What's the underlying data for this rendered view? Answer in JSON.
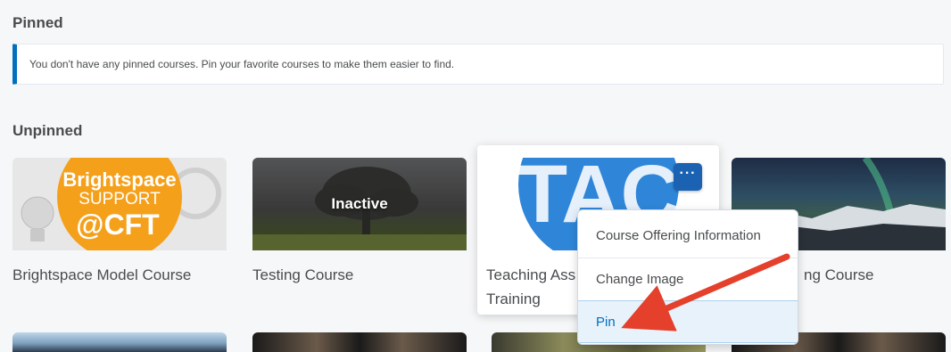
{
  "pinned": {
    "title": "Pinned",
    "empty_message": "You don't have any pinned courses. Pin your favorite courses to make them easier to find."
  },
  "unpinned": {
    "title": "Unpinned",
    "courses": [
      {
        "name": "Brightspace Model Course",
        "image_text": [
          "Brightspace",
          "SUPPORT",
          "@CFT"
        ]
      },
      {
        "name": "Testing Course",
        "overlay": "Inactive"
      },
      {
        "name": "Teaching Ass",
        "name_line2": "Training",
        "image_text": "TAC"
      },
      {
        "name": "ng Course"
      }
    ]
  },
  "course_menu": {
    "more_label": "···",
    "items": [
      {
        "label": "Course Offering Information"
      },
      {
        "label": "Change Image"
      },
      {
        "label": "Pin"
      }
    ]
  },
  "colors": {
    "primary": "#006fbf",
    "more_button": "#1b62b3",
    "annotation_arrow": "#e4402b",
    "brightspace_orange": "#f5a01a"
  }
}
